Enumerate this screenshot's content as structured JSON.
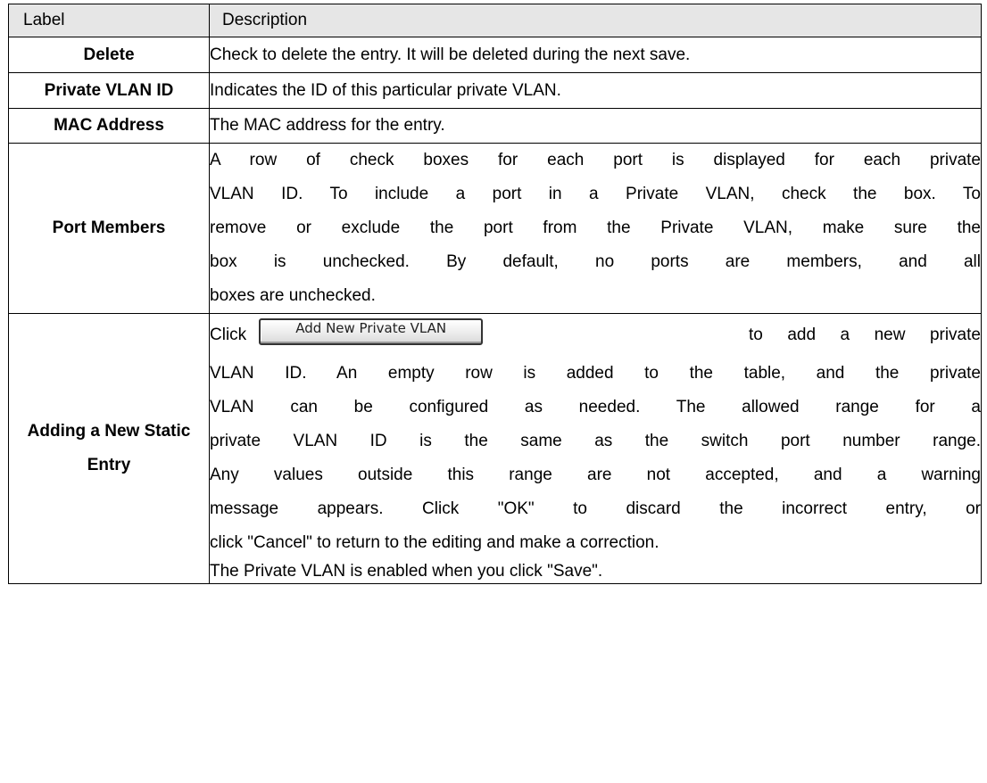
{
  "table": {
    "header": {
      "label": "Label",
      "description": "Description"
    },
    "rows": [
      {
        "label": "Delete",
        "description": "Check to delete the entry. It will be deleted during the next save."
      },
      {
        "label": "Private VLAN ID",
        "description": "Indicates the ID of this particular private VLAN."
      },
      {
        "label": "MAC Address",
        "description": "The MAC address for the entry."
      },
      {
        "label": "Port Members",
        "description_lines": [
          "A row of check boxes for each port is displayed for each private",
          "VLAN ID. To include a port in a Private VLAN, check the box. To",
          "remove or exclude the port from the Private VLAN, make sure the",
          "box is unchecked. By default, no ports are members, and all",
          "boxes are unchecked."
        ]
      },
      {
        "label_lines": [
          "Adding a New Static",
          "Entry"
        ],
        "click_word": "Click",
        "button_label": "Add New Private VLAN",
        "click_tail": [
          "to",
          "add",
          "a",
          "new",
          "private"
        ],
        "description_lines": [
          "VLAN ID. An empty row is added to the table, and the private",
          "VLAN can be configured as needed. The allowed range for a",
          "private VLAN ID is the same as the switch port number range.",
          "Any values outside this range are not accepted, and a warning",
          "message appears. Click \"OK\" to discard the incorrect entry, or",
          "click \"Cancel\" to return to the editing and make a correction.",
          "The Private VLAN is enabled when you click \"Save\"."
        ]
      }
    ]
  }
}
